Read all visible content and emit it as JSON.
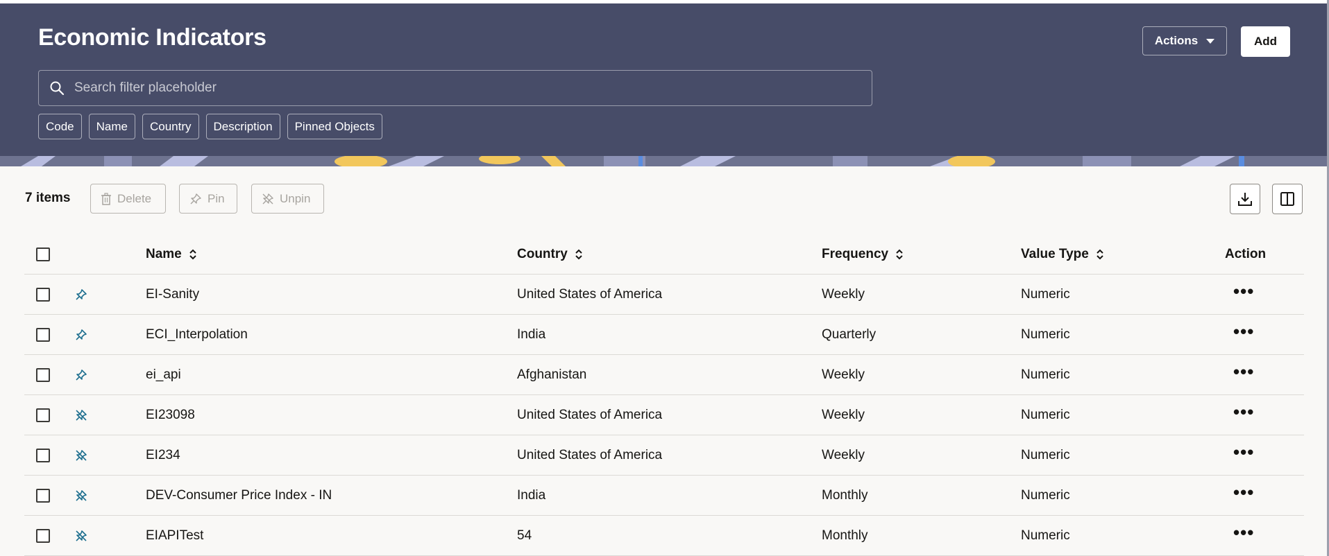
{
  "header": {
    "title": "Economic Indicators",
    "actions_label": "Actions",
    "add_label": "Add"
  },
  "search": {
    "placeholder": "Search filter placeholder",
    "value": ""
  },
  "filter_chips": [
    "Code",
    "Name",
    "Country",
    "Description",
    "Pinned Objects"
  ],
  "toolbar": {
    "count_label": "7 items",
    "delete_label": "Delete",
    "pin_label": "Pin",
    "unpin_label": "Unpin"
  },
  "table": {
    "columns": [
      "Name",
      "Country",
      "Frequency",
      "Value Type",
      "Action"
    ],
    "rows": [
      {
        "pinned": true,
        "name": "EI-Sanity",
        "country": "United States of America",
        "frequency": "Weekly",
        "value_type": "Numeric"
      },
      {
        "pinned": true,
        "name": "ECI_Interpolation",
        "country": "India",
        "frequency": "Quarterly",
        "value_type": "Numeric"
      },
      {
        "pinned": true,
        "name": "ei_api",
        "country": "Afghanistan",
        "frequency": "Weekly",
        "value_type": "Numeric"
      },
      {
        "pinned": false,
        "name": "EI23098",
        "country": "United States of America",
        "frequency": "Weekly",
        "value_type": "Numeric"
      },
      {
        "pinned": false,
        "name": "EI234",
        "country": "United States of America",
        "frequency": "Weekly",
        "value_type": "Numeric"
      },
      {
        "pinned": false,
        "name": "DEV-Consumer Price Index - IN",
        "country": "India",
        "frequency": "Monthly",
        "value_type": "Numeric"
      },
      {
        "pinned": false,
        "name": "EIAPITest",
        "country": "54",
        "frequency": "Monthly",
        "value_type": "Numeric"
      }
    ]
  },
  "colors": {
    "header_bg": "#474c68",
    "content_bg": "#f9f8f6",
    "pin_icon": "#1e6f8f"
  }
}
